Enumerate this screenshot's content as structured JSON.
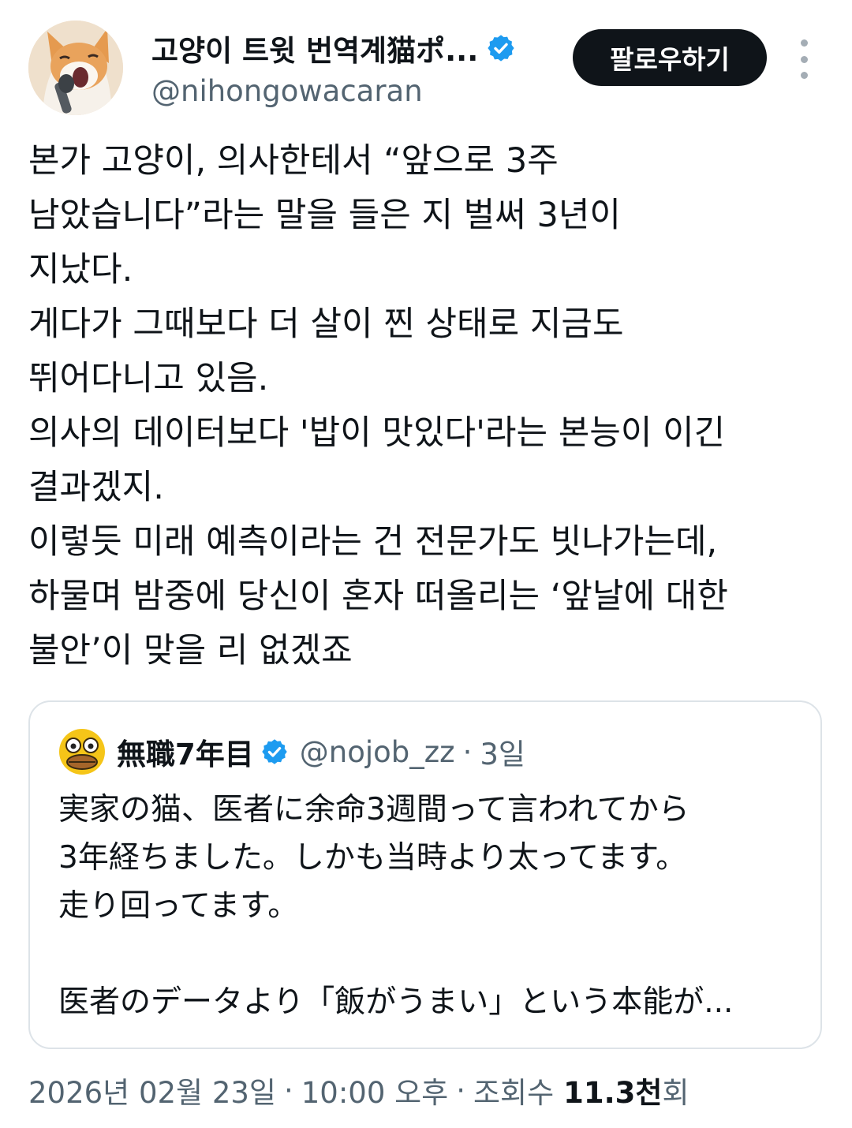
{
  "author": {
    "display_name": "고양이 트윗 번역계猫ポ...",
    "handle": "@nihongowacaran",
    "avatar_icon": "cat-singing-avatar",
    "verified_icon": "verified-badge-icon"
  },
  "follow_button": {
    "label": "팔로우하기"
  },
  "more_icon": "more-vertical-icon",
  "tweet": {
    "text": "본가 고양이, 의사한테서 “앞으로 3주\n남았습니다”라는 말을 들은 지 벌써 3년이\n지났다.\n게다가 그때보다 더 살이 찐 상태로 지금도\n뛰어다니고 있음.\n의사의 데이터보다 '밥이 맛있다'라는 본능이 이긴\n결과겠지.\n이렇듯 미래 예측이라는 건 전문가도 빗나가는데,\n하물며 밤중에 당신이 혼자 떠올리는 ‘앞날에 대한\n불안’이 맞을 리 없겠죠"
  },
  "quote": {
    "avatar_icon": "surprised-face-avatar",
    "display_name": "無職7年目",
    "handle": "@nojob_zz",
    "separator": "·",
    "time": "3일",
    "text": "実家の猫、医者に余命3週間って言われてから\n3年経ちました。しかも当時より太ってます。\n走り回ってます。\n\n医者のデータより「飯がうまい」という本能が..."
  },
  "meta": {
    "date": "2026년 02월 23일",
    "separator": "·",
    "time": "10:00 오후",
    "views_label": "조회수",
    "views_count": "11.3천",
    "views_suffix": "회"
  },
  "colors": {
    "text_primary": "#0f1419",
    "text_secondary": "#536471",
    "verified_blue": "#1d9bf0",
    "button_bg": "#0f1419",
    "border": "#dde3e8"
  }
}
